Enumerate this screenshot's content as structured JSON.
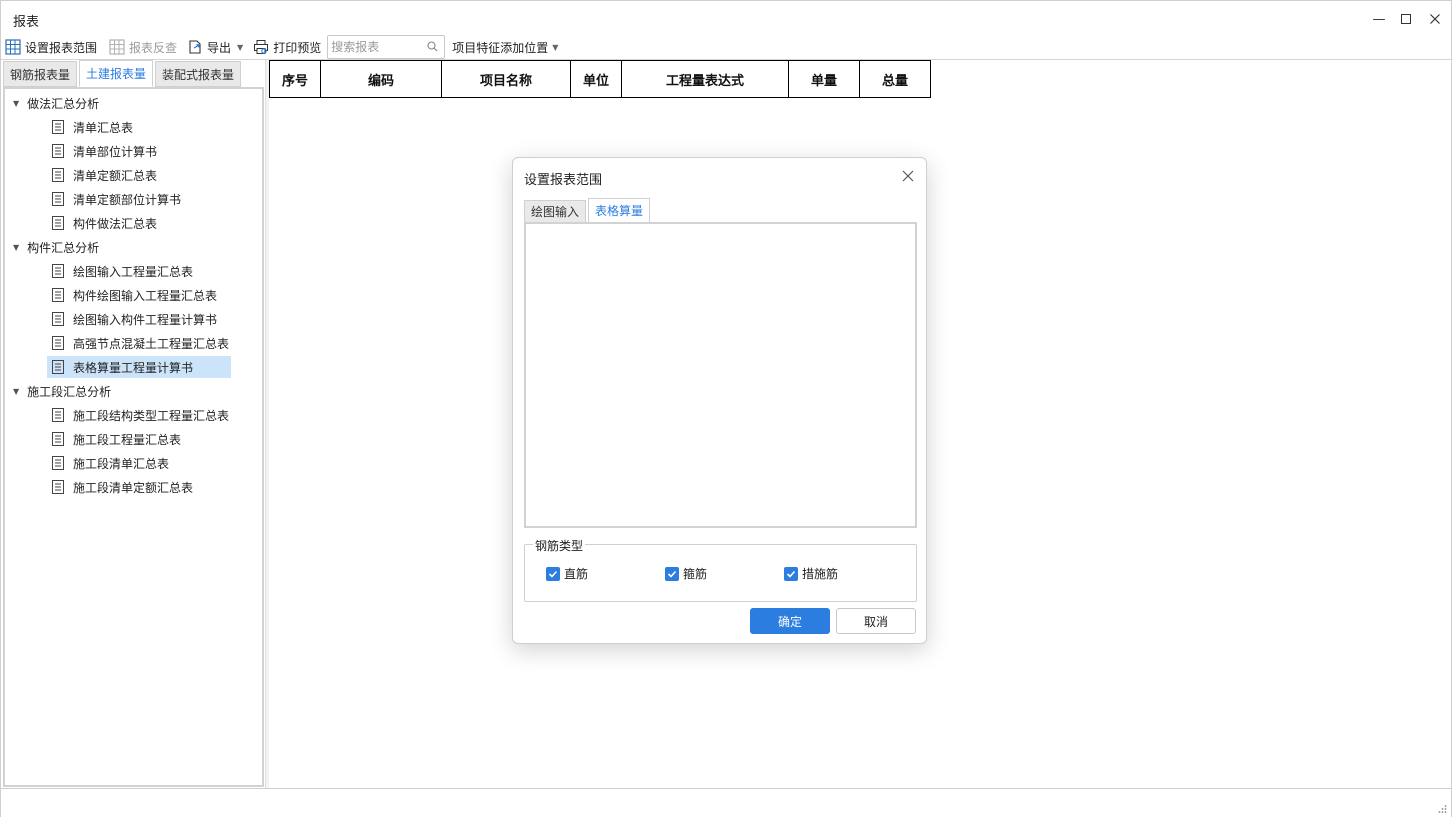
{
  "window": {
    "title": "报表",
    "controls": {
      "minimize": "—",
      "maximize": "☐",
      "close": "✕"
    }
  },
  "toolbar": {
    "set_range": "设置报表范围",
    "reverse_check": "报表反查",
    "export": "导出",
    "print_preview": "打印预览",
    "search_placeholder": "搜索报表",
    "feature_position": "项目特征添加位置"
  },
  "left_tabs": [
    {
      "label": "钢筋报表量",
      "active": false
    },
    {
      "label": "土建报表量",
      "active": true
    },
    {
      "label": "装配式报表量",
      "active": false
    }
  ],
  "tree": [
    {
      "label": "做法汇总分析",
      "items": [
        "清单汇总表",
        "清单部位计算书",
        "清单定额汇总表",
        "清单定额部位计算书",
        "构件做法汇总表"
      ]
    },
    {
      "label": "构件汇总分析",
      "items": [
        "绘图输入工程量汇总表",
        "构件绘图输入工程量汇总表",
        "绘图输入构件工程量计算书",
        "高强节点混凝土工程量汇总表",
        "表格算量工程量计算书"
      ]
    },
    {
      "label": "施工段汇总分析",
      "items": [
        "施工段结构类型工程量汇总表",
        "施工段工程量汇总表",
        "施工段清单汇总表",
        "施工段清单定额汇总表"
      ]
    }
  ],
  "selected_item": "表格算量工程量计算书",
  "table": {
    "headers": [
      "序号",
      "编码",
      "项目名称",
      "单位",
      "工程量表达式",
      "单量",
      "总量"
    ]
  },
  "dialog": {
    "title": "设置报表范围",
    "tabs": [
      {
        "label": "绘图输入",
        "active": false
      },
      {
        "label": "表格算量",
        "active": true
      }
    ],
    "group_label": "钢筋类型",
    "checkboxes": [
      {
        "label": "直筋",
        "checked": true
      },
      {
        "label": "箍筋",
        "checked": true
      },
      {
        "label": "措施筋",
        "checked": true
      }
    ],
    "ok": "确定",
    "cancel": "取消"
  },
  "colors": {
    "accent": "#2b7de0",
    "selected_bg": "#cce4fa"
  }
}
